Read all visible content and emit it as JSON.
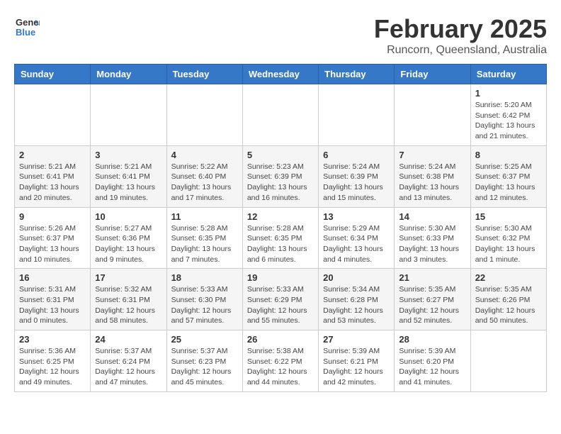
{
  "logo": {
    "general": "General",
    "blue": "Blue"
  },
  "title": "February 2025",
  "subtitle": "Runcorn, Queensland, Australia",
  "days_of_week": [
    "Sunday",
    "Monday",
    "Tuesday",
    "Wednesday",
    "Thursday",
    "Friday",
    "Saturday"
  ],
  "weeks": [
    [
      {
        "day": "",
        "info": ""
      },
      {
        "day": "",
        "info": ""
      },
      {
        "day": "",
        "info": ""
      },
      {
        "day": "",
        "info": ""
      },
      {
        "day": "",
        "info": ""
      },
      {
        "day": "",
        "info": ""
      },
      {
        "day": "1",
        "info": "Sunrise: 5:20 AM\nSunset: 6:42 PM\nDaylight: 13 hours\nand 21 minutes."
      }
    ],
    [
      {
        "day": "2",
        "info": "Sunrise: 5:21 AM\nSunset: 6:41 PM\nDaylight: 13 hours\nand 20 minutes."
      },
      {
        "day": "3",
        "info": "Sunrise: 5:21 AM\nSunset: 6:41 PM\nDaylight: 13 hours\nand 19 minutes."
      },
      {
        "day": "4",
        "info": "Sunrise: 5:22 AM\nSunset: 6:40 PM\nDaylight: 13 hours\nand 17 minutes."
      },
      {
        "day": "5",
        "info": "Sunrise: 5:23 AM\nSunset: 6:39 PM\nDaylight: 13 hours\nand 16 minutes."
      },
      {
        "day": "6",
        "info": "Sunrise: 5:24 AM\nSunset: 6:39 PM\nDaylight: 13 hours\nand 15 minutes."
      },
      {
        "day": "7",
        "info": "Sunrise: 5:24 AM\nSunset: 6:38 PM\nDaylight: 13 hours\nand 13 minutes."
      },
      {
        "day": "8",
        "info": "Sunrise: 5:25 AM\nSunset: 6:37 PM\nDaylight: 13 hours\nand 12 minutes."
      }
    ],
    [
      {
        "day": "9",
        "info": "Sunrise: 5:26 AM\nSunset: 6:37 PM\nDaylight: 13 hours\nand 10 minutes."
      },
      {
        "day": "10",
        "info": "Sunrise: 5:27 AM\nSunset: 6:36 PM\nDaylight: 13 hours\nand 9 minutes."
      },
      {
        "day": "11",
        "info": "Sunrise: 5:28 AM\nSunset: 6:35 PM\nDaylight: 13 hours\nand 7 minutes."
      },
      {
        "day": "12",
        "info": "Sunrise: 5:28 AM\nSunset: 6:35 PM\nDaylight: 13 hours\nand 6 minutes."
      },
      {
        "day": "13",
        "info": "Sunrise: 5:29 AM\nSunset: 6:34 PM\nDaylight: 13 hours\nand 4 minutes."
      },
      {
        "day": "14",
        "info": "Sunrise: 5:30 AM\nSunset: 6:33 PM\nDaylight: 13 hours\nand 3 minutes."
      },
      {
        "day": "15",
        "info": "Sunrise: 5:30 AM\nSunset: 6:32 PM\nDaylight: 13 hours\nand 1 minute."
      }
    ],
    [
      {
        "day": "16",
        "info": "Sunrise: 5:31 AM\nSunset: 6:31 PM\nDaylight: 13 hours\nand 0 minutes."
      },
      {
        "day": "17",
        "info": "Sunrise: 5:32 AM\nSunset: 6:31 PM\nDaylight: 12 hours\nand 58 minutes."
      },
      {
        "day": "18",
        "info": "Sunrise: 5:33 AM\nSunset: 6:30 PM\nDaylight: 12 hours\nand 57 minutes."
      },
      {
        "day": "19",
        "info": "Sunrise: 5:33 AM\nSunset: 6:29 PM\nDaylight: 12 hours\nand 55 minutes."
      },
      {
        "day": "20",
        "info": "Sunrise: 5:34 AM\nSunset: 6:28 PM\nDaylight: 12 hours\nand 53 minutes."
      },
      {
        "day": "21",
        "info": "Sunrise: 5:35 AM\nSunset: 6:27 PM\nDaylight: 12 hours\nand 52 minutes."
      },
      {
        "day": "22",
        "info": "Sunrise: 5:35 AM\nSunset: 6:26 PM\nDaylight: 12 hours\nand 50 minutes."
      }
    ],
    [
      {
        "day": "23",
        "info": "Sunrise: 5:36 AM\nSunset: 6:25 PM\nDaylight: 12 hours\nand 49 minutes."
      },
      {
        "day": "24",
        "info": "Sunrise: 5:37 AM\nSunset: 6:24 PM\nDaylight: 12 hours\nand 47 minutes."
      },
      {
        "day": "25",
        "info": "Sunrise: 5:37 AM\nSunset: 6:23 PM\nDaylight: 12 hours\nand 45 minutes."
      },
      {
        "day": "26",
        "info": "Sunrise: 5:38 AM\nSunset: 6:22 PM\nDaylight: 12 hours\nand 44 minutes."
      },
      {
        "day": "27",
        "info": "Sunrise: 5:39 AM\nSunset: 6:21 PM\nDaylight: 12 hours\nand 42 minutes."
      },
      {
        "day": "28",
        "info": "Sunrise: 5:39 AM\nSunset: 6:20 PM\nDaylight: 12 hours\nand 41 minutes."
      },
      {
        "day": "",
        "info": ""
      }
    ]
  ]
}
